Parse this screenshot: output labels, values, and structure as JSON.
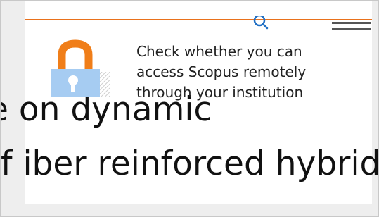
{
  "tooltip": {
    "line1": "Check whether you can",
    "line2": "access Scopus remotely",
    "line3": "through your institution"
  },
  "title": {
    "line1": "e on dynamic",
    "line2": "f iber reinforced hybrid"
  },
  "icons": {
    "search": "search-icon",
    "menu": "menu-icon",
    "lock": "open-lock-icon"
  },
  "colors": {
    "accent": "#e9711c",
    "lock_body": "#a6ccf2",
    "lock_shackle": "#f07e19"
  }
}
